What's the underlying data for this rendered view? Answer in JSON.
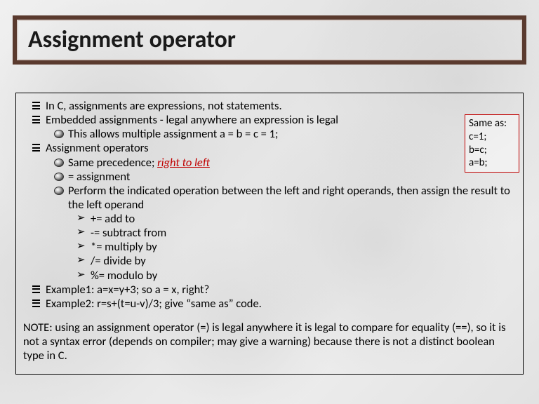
{
  "title": "Assignment operator",
  "bullets": {
    "l1_0": "In C, assignments are expressions, not statements.",
    "l1_1": "Embedded assignments - legal anywhere an expression is legal",
    "l2_0": "This allows multiple assignment a = b = c = 1;",
    "l1_2": "Assignment operators",
    "l2_1_pre": "Same precedence; ",
    "l2_1_em": "right to left",
    "l2_2": "= assignment",
    "l2_3": "Perform the indicated operation between the left and right operands, then assign the result to the left operand",
    "l3_0": "+= add to",
    "l3_1": "-= subtract from",
    "l3_2": "*= multiply by",
    "l3_3": "/= divide by",
    "l3_4": "%= modulo by",
    "l1_3": "Example1: a=x=y+3; so a = x, right?",
    "l1_4": "Example2: r=s+(t=u-v)/3; give “same as” code."
  },
  "note": "NOTE: using an assignment operator (=) is legal anywhere it is legal to compare for equality (==), so it is not a syntax error (depends on compiler; may give a warning) because there is not a distinct boolean type in C.",
  "sidebox": {
    "l0": "Same as:",
    "l1": "c=1;",
    "l2": "b=c;",
    "l3": "a=b;"
  }
}
